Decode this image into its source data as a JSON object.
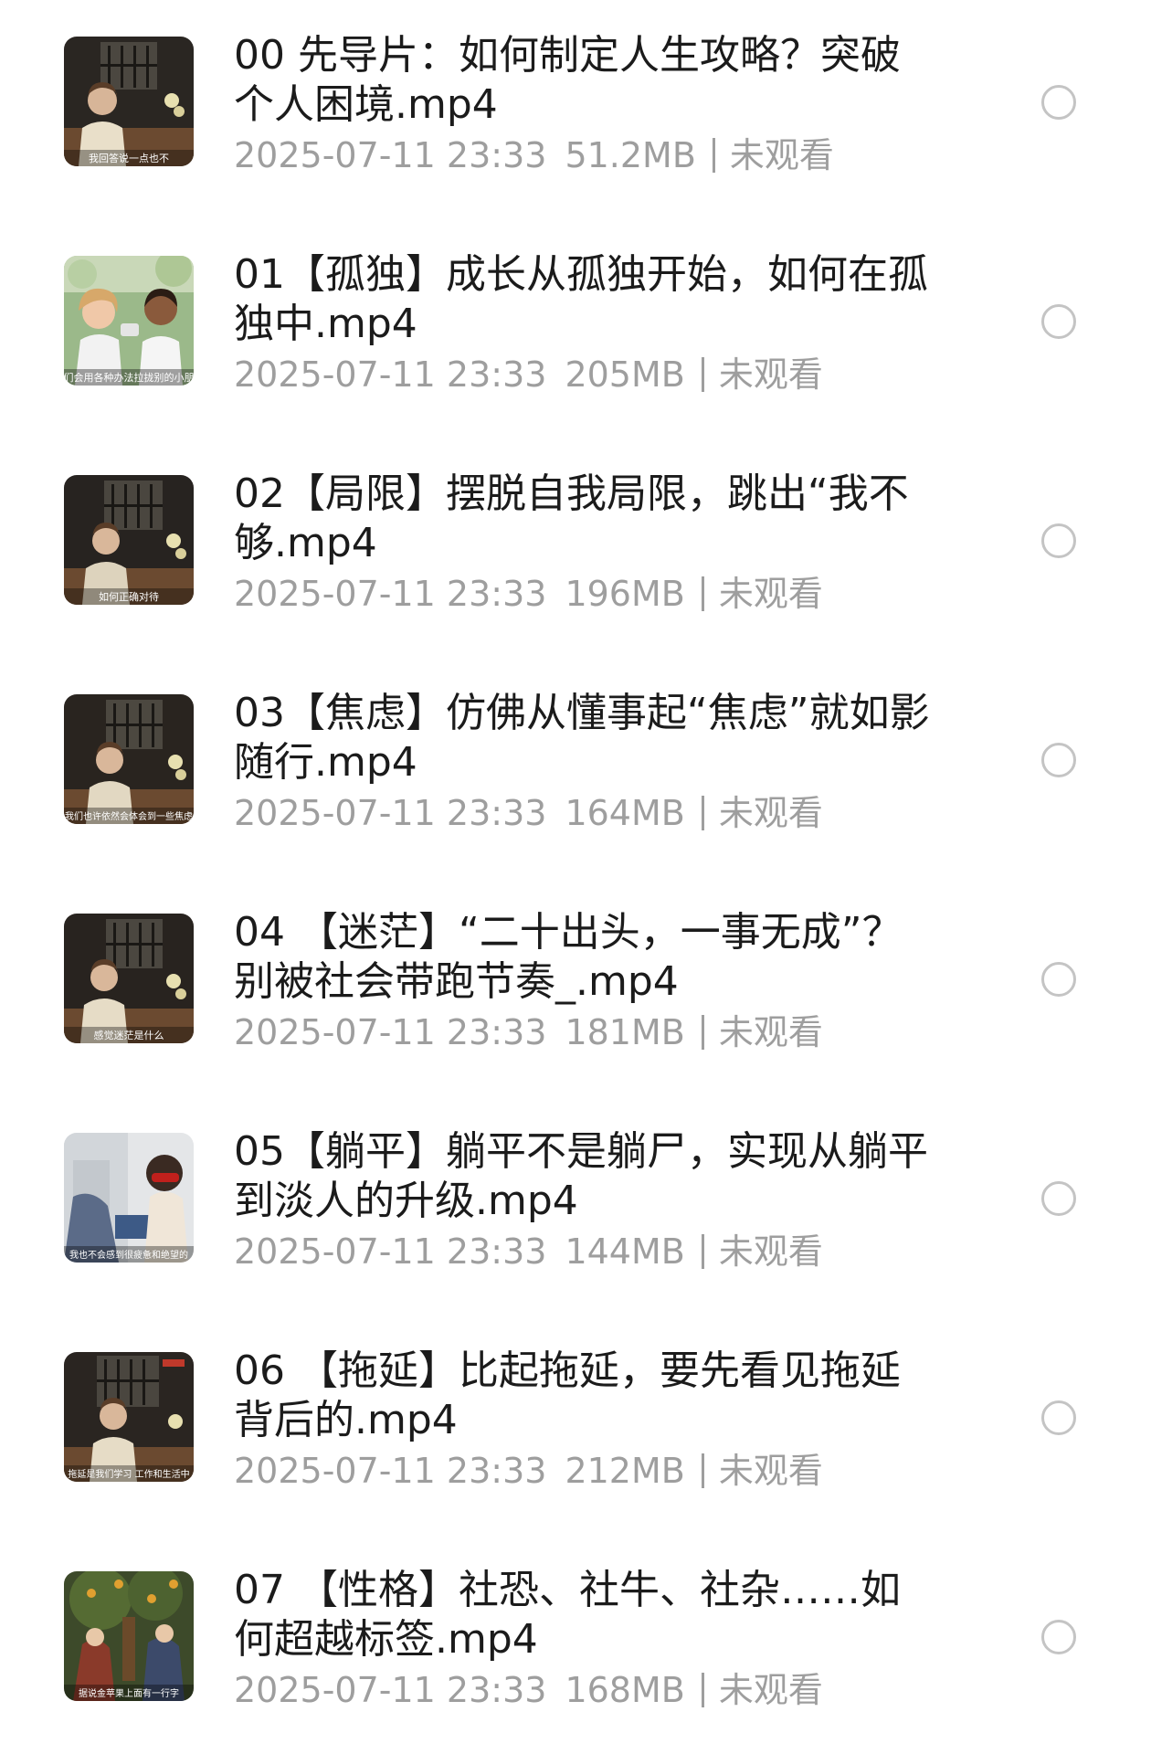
{
  "files": [
    {
      "title": "00 先导片：如何制定人生攻略？突破个人困境.mp4",
      "date": "2025-07-11 23:33",
      "size": "51.2MB",
      "status": "未观看",
      "thumb_caption": "我回答说一点也不",
      "thumb_scene": "studio-woman-icon"
    },
    {
      "title": "01【孤独】成长从孤独开始，如何在孤独中.mp4",
      "date": "2025-07-11 23:33",
      "size": "205MB",
      "status": "未观看",
      "thumb_caption": "们会用各种办法拉拢别的小朋",
      "thumb_scene": "children-outdoor-icon"
    },
    {
      "title": "02【局限】摆脱自我局限，跳出“我不够.mp4",
      "date": "2025-07-11 23:33",
      "size": "196MB",
      "status": "未观看",
      "thumb_caption": "如何正确对待",
      "thumb_scene": "studio-woman-icon"
    },
    {
      "title": "03【焦虑】仿佛从懂事起“焦虑”就如影随行.mp4",
      "date": "2025-07-11 23:33",
      "size": "164MB",
      "status": "未观看",
      "thumb_caption": "我们也许依然会体会到一些焦虑",
      "thumb_scene": "studio-woman-icon"
    },
    {
      "title": "04 【迷茫】“二十出头，一事无成”？别被社会带跑节奏_.mp4",
      "date": "2025-07-11 23:33",
      "size": "181MB",
      "status": "未观看",
      "thumb_caption": "感觉迷茫是什么",
      "thumb_scene": "studio-woman-icon"
    },
    {
      "title": "05【躺平】躺平不是躺尸，实现从躺平到淡人的升级.mp4",
      "date": "2025-07-11 23:33",
      "size": "144MB",
      "status": "未观看",
      "thumb_caption": "我也不会感到很疲惫和绝望的",
      "thumb_scene": "people-indoor-icon"
    },
    {
      "title": "06 【拖延】比起拖延，要先看见拖延背后的.mp4",
      "date": "2025-07-11 23:33",
      "size": "212MB",
      "status": "未观看",
      "thumb_caption": "拖延是我们学习 工作和生活中",
      "thumb_scene": "studio-woman-icon"
    },
    {
      "title": "07 【性格】社恐、社牛、社杂……如何超越标签.mp4",
      "date": "2025-07-11 23:33",
      "size": "168MB",
      "status": "未观看",
      "thumb_caption": "据说金苹果上面有一行字",
      "thumb_scene": "painting-tree-icon"
    }
  ]
}
